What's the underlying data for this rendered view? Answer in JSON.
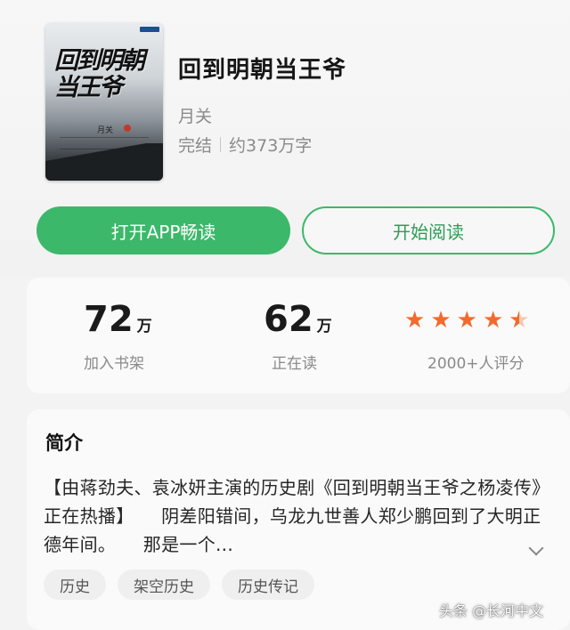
{
  "book": {
    "title": "回到明朝当王爷",
    "author": "月关",
    "status": "完结",
    "word_count": "约373万字",
    "cover_title": "回到明朝当王爷",
    "cover_author": "月关"
  },
  "buttons": {
    "open_app": "打开APP畅读",
    "start_reading": "开始阅读"
  },
  "stats": {
    "bookshelf_value": "72",
    "bookshelf_unit": "万",
    "bookshelf_label": "加入书架",
    "reading_value": "62",
    "reading_unit": "万",
    "reading_label": "正在读",
    "rating_stars": 4.5,
    "rating_label": "2000+人评分",
    "star_color": "#f26a2c"
  },
  "intro": {
    "heading": "简介",
    "text": "【由蒋劲夫、袁冰妍主演的历史剧《回到明朝当王爷之杨凌传》正在热播】　　阴差阳错间，乌龙九世善人郑少鹏回到了大明正德年间。　　那是一个..."
  },
  "tags": [
    "历史",
    "架空历史",
    "历史传记"
  ],
  "watermark": "头条 @长河中文",
  "colors": {
    "accent": "#3cb86a"
  }
}
